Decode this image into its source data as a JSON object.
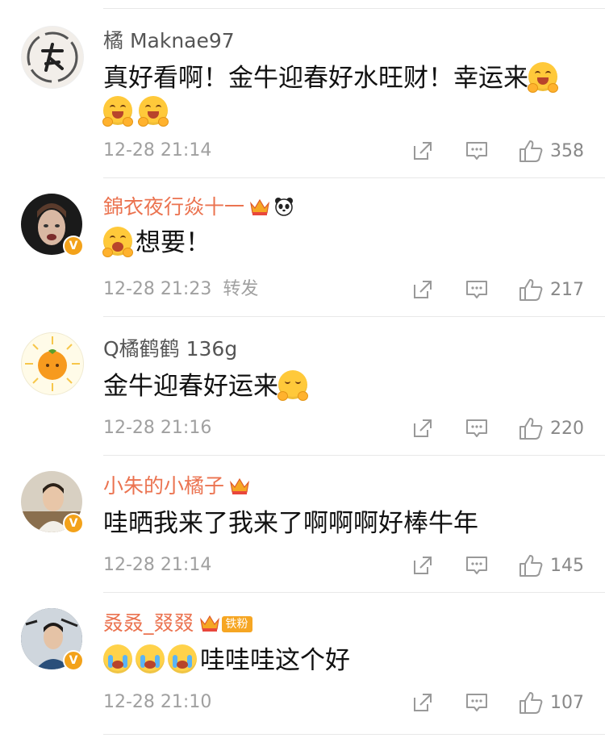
{
  "comments": [
    {
      "username": "橘 Maknae97",
      "text": "真好看啊！金牛迎春好水旺财！幸运来",
      "time": "12-28 21:14",
      "reply": "",
      "likes": "358"
    },
    {
      "username": "錦衣夜行焱十一",
      "text": "想要！",
      "time": "12-28 21:23",
      "reply": "转发",
      "likes": "217"
    },
    {
      "username": "Q橘鹤鹤 136g",
      "text": "金牛迎春好运来",
      "time": "12-28 21:16",
      "reply": "",
      "likes": "220"
    },
    {
      "username": "小朱的小橘子",
      "text": "哇晒我来了我来了啊啊啊好棒牛年",
      "time": "12-28 21:14",
      "reply": "",
      "likes": "145"
    },
    {
      "username": "叒叒_叕叕",
      "fan_badge": "铁粉",
      "text": "哇哇哇这个好",
      "time": "12-28 21:10",
      "reply": "",
      "likes": "107"
    }
  ],
  "colors": {
    "vip_name": "#eb7350",
    "plain_name": "#555555",
    "meta": "#a0a0a0",
    "verified_badge": "#f3a21a"
  },
  "icons": [
    "share-icon",
    "comment-icon",
    "like-icon",
    "crown-icon",
    "panda-icon",
    "verified-icon",
    "grin-emoji",
    "scared-emoji",
    "blush-emoji",
    "cry-emoji"
  ]
}
